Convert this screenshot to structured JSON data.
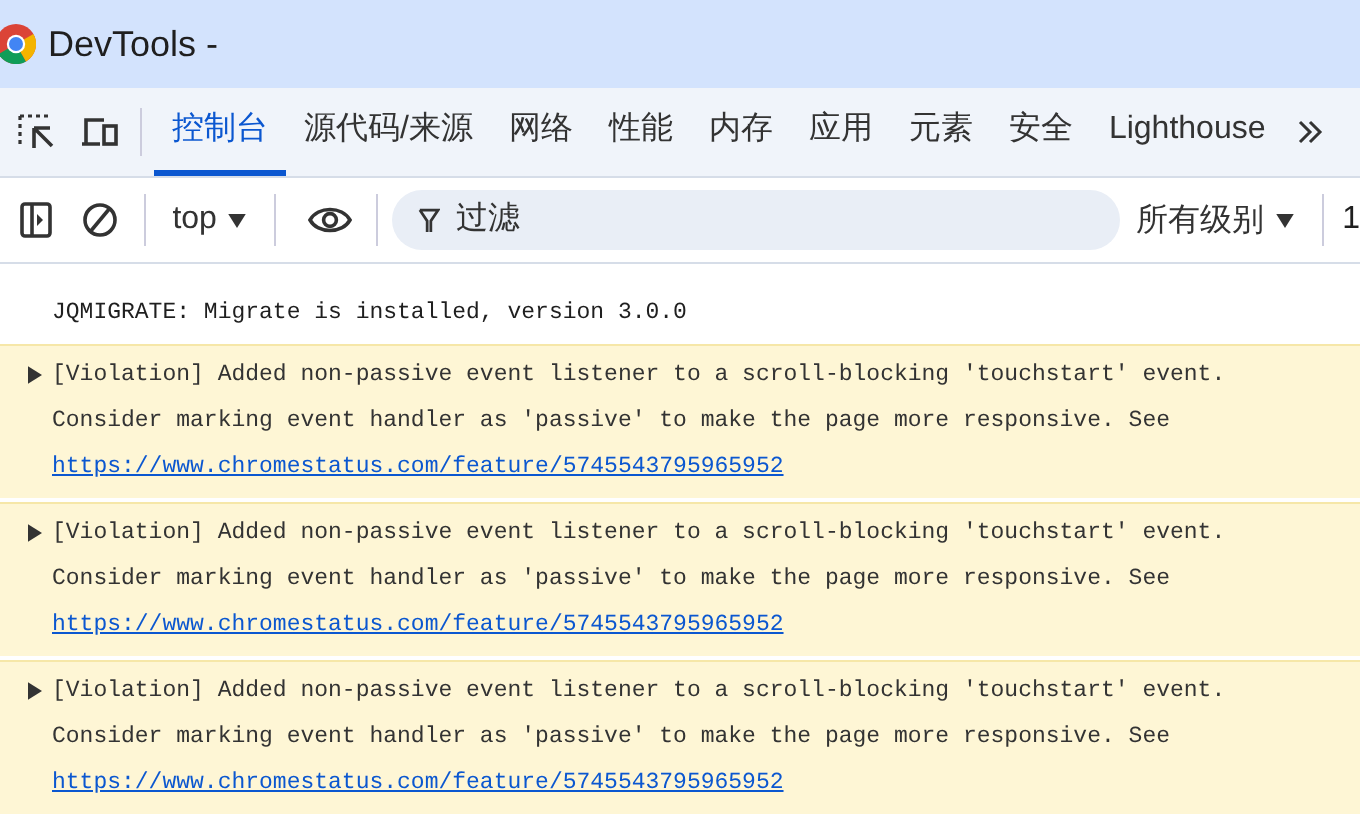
{
  "window": {
    "title": "DevTools -"
  },
  "tabs": [
    {
      "label": "控制台",
      "selected": true
    },
    {
      "label": "源代码/来源",
      "selected": false
    },
    {
      "label": "网络",
      "selected": false
    },
    {
      "label": "性能",
      "selected": false
    },
    {
      "label": "内存",
      "selected": false
    },
    {
      "label": "应用",
      "selected": false
    },
    {
      "label": "元素",
      "selected": false
    },
    {
      "label": "安全",
      "selected": false
    },
    {
      "label": "Lighthouse",
      "selected": false
    }
  ],
  "toolbar": {
    "context": "top",
    "filter": {
      "placeholder": "过滤"
    },
    "levels": "所有级别",
    "issues": "1"
  },
  "messages": [
    {
      "kind": "log",
      "text": "JQMIGRATE: Migrate is installed, version 3.0.0"
    },
    {
      "kind": "warning",
      "text": "[Violation] Added non-passive event listener to a scroll-blocking 'touchstart' event. Consider marking event handler as 'passive' to make the page more responsive. See",
      "link": "https://www.chromestatus.com/feature/5745543795965952"
    },
    {
      "kind": "warning",
      "text": "[Violation] Added non-passive event listener to a scroll-blocking 'touchstart' event. Consider marking event handler as 'passive' to make the page more responsive. See",
      "link": "https://www.chromestatus.com/feature/5745543795965952"
    },
    {
      "kind": "warning",
      "text": "[Violation] Added non-passive event listener to a scroll-blocking 'touchstart' event. Consider marking event handler as 'passive' to make the page more responsive. See",
      "link": "https://www.chromestatus.com/feature/5745543795965952"
    }
  ]
}
